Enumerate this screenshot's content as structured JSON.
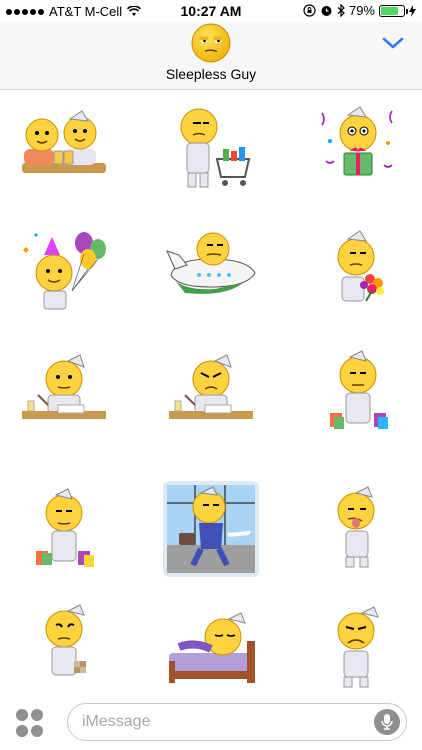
{
  "status_bar": {
    "carrier": "AT&T M-Cell",
    "time": "10:27 AM",
    "battery_percent": "79%",
    "battery_level": 0.79,
    "icons": [
      "signal-dots",
      "wifi-icon",
      "rotation-lock-icon",
      "alarm-icon",
      "bluetooth-icon",
      "battery-icon",
      "charging-icon"
    ]
  },
  "header": {
    "contact_name": "Sleepless Guy",
    "avatar_icon": "emoji-face-avatar",
    "collapse_icon": "chevron-down-icon",
    "accent_color": "#3478f6"
  },
  "stickers": [
    "two-guys-drinking-beer-sticker",
    "guy-with-shopping-cart-sticker",
    "guy-with-gift-box-sticker",
    "guy-with-balloons-party-sticker",
    "guy-as-airplane-sticker",
    "guy-with-flower-bouquet-sticker",
    "guy-writing-at-desk-sticker",
    "guy-grumpy-writing-at-desk-sticker",
    "guy-with-shopping-bags-sticker",
    "guy-holding-shopping-bags-sticker",
    "guy-traveling-with-suitcase-sticker",
    "guy-sticking-tongue-out-sticker",
    "guy-with-censored-sticker",
    "guy-sleeping-in-bed-sticker",
    "guy-frowning-standing-sticker"
  ],
  "input_bar": {
    "placeholder": "iMessage",
    "apps_icon": "app-drawer-icon",
    "mic_icon": "microphone-icon"
  }
}
